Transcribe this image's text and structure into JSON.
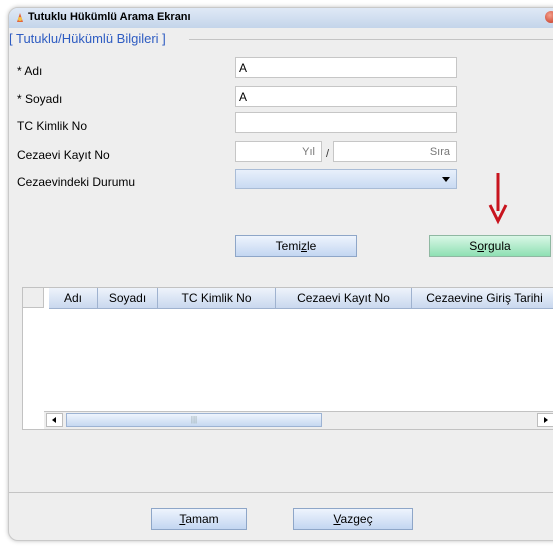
{
  "window": {
    "title": "Tutuklu Hükümlü Arama Ekranı"
  },
  "group": {
    "legend": "[ Tutuklu/Hükümlü Bilgileri ]"
  },
  "form": {
    "adi": {
      "label": "* Adı",
      "value": "A"
    },
    "soyadi": {
      "label": "* Soyadı",
      "value": "A"
    },
    "tc": {
      "label": "TC Kimlik No",
      "value": ""
    },
    "kayit": {
      "label": "Cezaevi Kayıt No",
      "yil_hint": "Yıl",
      "separator": "/",
      "sira_hint": "Sıra"
    },
    "durum": {
      "label": "Cezaevindeki Durumu",
      "value": ""
    }
  },
  "buttons": {
    "temizle_pre": "Temi",
    "temizle_mn": "z",
    "temizle_post": "le",
    "sorgula_pre": "S",
    "sorgula_mn": "o",
    "sorgula_post": "rgula",
    "tamam_mn": "T",
    "tamam_post": "amam",
    "vazgec_mn": "V",
    "vazgec_post": "azgeç"
  },
  "table": {
    "columns": [
      "Adı",
      "Soyadı",
      "TC Kimlik No",
      "Cezaevi Kayıt No",
      "Cezaevine Giriş Tarihi"
    ],
    "rows": []
  },
  "colors": {
    "legend": "#2e5cc2",
    "sorgula_button": "#8fe0b3",
    "annotation_arrow": "#c8141e"
  },
  "icons": {
    "app": "app-icon",
    "close": "close-icon",
    "annotation": "red-arrow-down-icon"
  }
}
